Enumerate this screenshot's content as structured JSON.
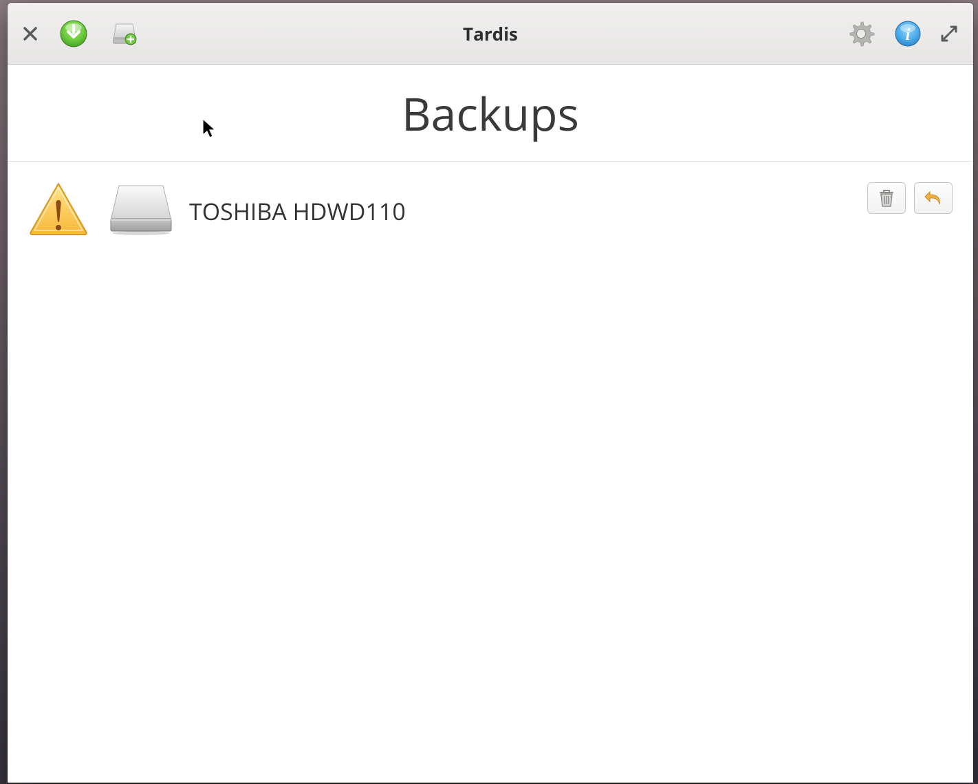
{
  "window": {
    "title": "Tardis"
  },
  "page": {
    "heading": "Backups"
  },
  "backups": [
    {
      "name": "TOSHIBA HDWD110"
    }
  ]
}
